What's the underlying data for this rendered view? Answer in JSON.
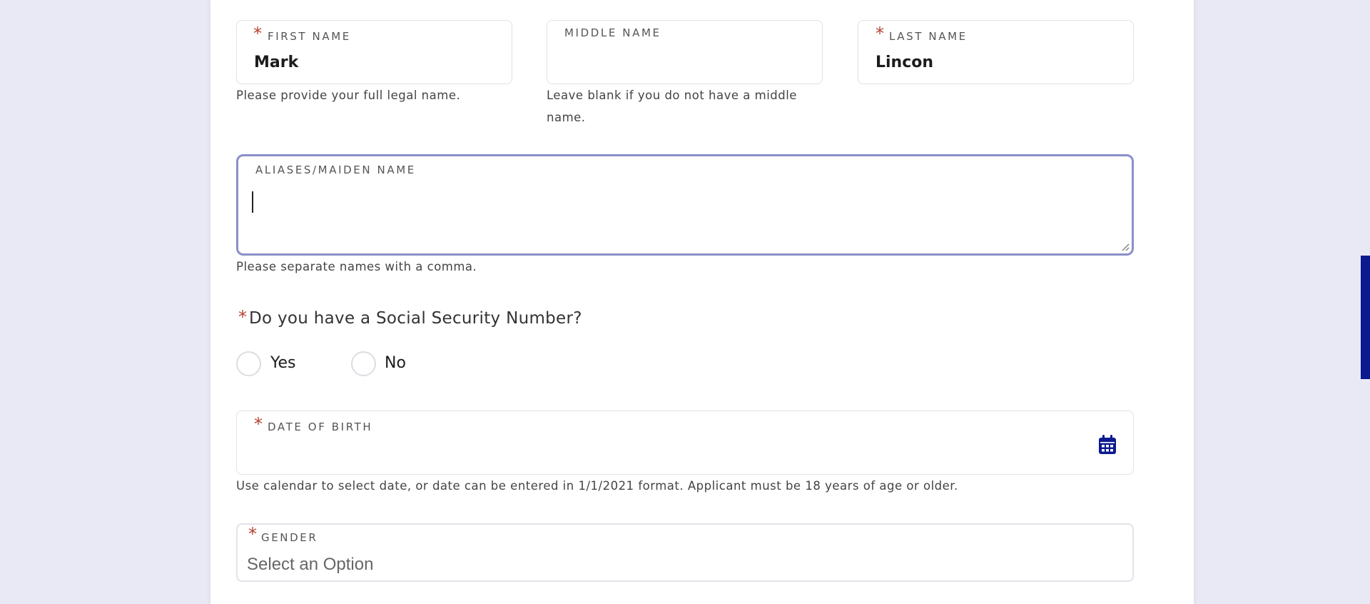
{
  "colors": {
    "accent": "#0c1a8f",
    "required_star": "#b5412f",
    "focus_border": "#8a8fc9",
    "background": "#e9e9f6"
  },
  "form": {
    "required_marker": "*",
    "first_name": {
      "label": "FIRST NAME",
      "value": "Mark",
      "helper": "Please provide your full legal name."
    },
    "middle_name": {
      "label": "MIDDLE NAME",
      "value": "",
      "helper": "Leave blank if you do not have a middle name."
    },
    "last_name": {
      "label": "LAST NAME",
      "value": "Lincon"
    },
    "aliases": {
      "label": "ALIASES/MAIDEN NAME",
      "value": "",
      "helper": "Please separate names with a comma."
    },
    "ssn_question": {
      "label": "Do you have a Social Security Number?",
      "options": [
        {
          "label": "Yes",
          "selected": false
        },
        {
          "label": "No",
          "selected": false
        }
      ]
    },
    "date_of_birth": {
      "label": "DATE OF BIRTH",
      "value": "",
      "icon": "calendar-icon",
      "helper": "Use calendar to select date, or date can be entered in 1/1/2021 format. Applicant must be 18 years of age or older."
    },
    "gender": {
      "label": "GENDER",
      "placeholder": "Select an Option"
    }
  }
}
